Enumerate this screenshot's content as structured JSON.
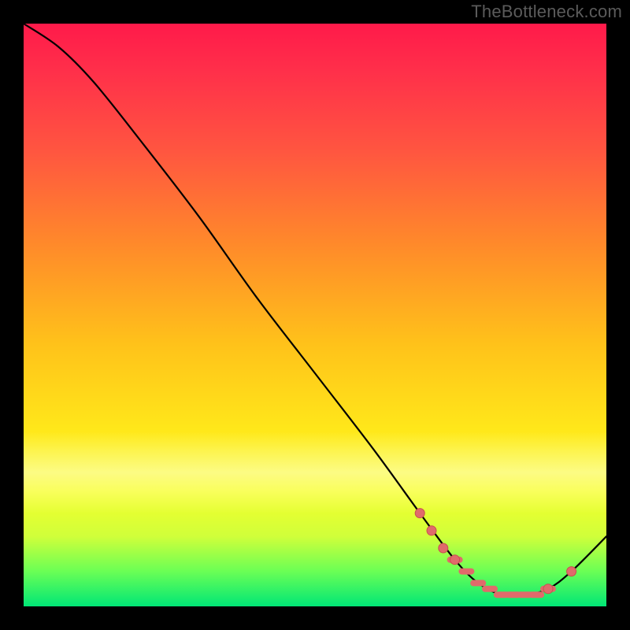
{
  "watermark": "TheBottleneck.com",
  "chart_data": {
    "type": "line",
    "title": "",
    "xlabel": "",
    "ylabel": "",
    "xlim": [
      0,
      100
    ],
    "ylim": [
      0,
      100
    ],
    "grid": false,
    "legend": false,
    "background_gradient": [
      "#ff1a4a",
      "#ff8a2a",
      "#ffe81a",
      "#00e676"
    ],
    "series": [
      {
        "name": "bottleneck-curve",
        "x": [
          0,
          6,
          12,
          20,
          30,
          40,
          50,
          60,
          68,
          74,
          78,
          82,
          86,
          90,
          94,
          100
        ],
        "y": [
          100,
          96,
          90,
          80,
          67,
          53,
          40,
          27,
          16,
          8,
          4,
          2,
          2,
          3,
          6,
          12
        ]
      }
    ],
    "highlight_cluster": {
      "name": "optimal-region-markers",
      "x": [
        68,
        70,
        72,
        74,
        76,
        78,
        80,
        82,
        84,
        86,
        88,
        90,
        94
      ],
      "y": [
        16,
        13,
        10,
        8,
        6,
        4,
        3,
        2,
        2,
        2,
        2,
        3,
        6
      ]
    }
  }
}
